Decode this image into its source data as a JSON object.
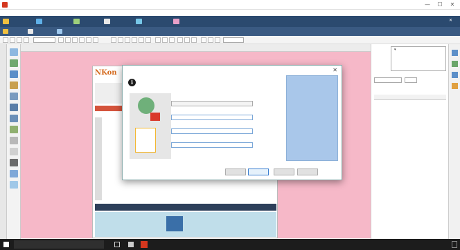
{
  "app": {
    "title": "",
    "window_controls": {
      "minimize": "—",
      "maximize": "☐",
      "close": "✕"
    }
  },
  "menubar": {
    "items": [
      "",
      "",
      "",
      "",
      "",
      "",
      "",
      "",
      "",
      "",
      "",
      "",
      "",
      ""
    ]
  },
  "ribbon": {
    "tabs": [
      {
        "label": ""
      },
      {
        "label": ""
      },
      {
        "label": ""
      },
      {
        "label": ""
      },
      {
        "label": ""
      },
      {
        "label": ""
      },
      {
        "label": ""
      }
    ],
    "right_icons": [
      "",
      "",
      "✕"
    ]
  },
  "ribbon2": {
    "tabs": [
      {
        "label": ""
      },
      {
        "label": ""
      },
      {
        "label": ""
      },
      {
        "label": ""
      }
    ]
  },
  "toolbar": {
    "font_size_value": "",
    "style_dropdown": "",
    "right_dropdowns": [
      "",
      "",
      ""
    ]
  },
  "editor": {
    "tabs": [
      "",
      "",
      "",
      ""
    ],
    "logo_text": "NKon",
    "bottom_banner_left": "",
    "bottom_banner_right": ""
  },
  "dialog": {
    "title": "",
    "close": "✕",
    "instruction": "",
    "provider_label": "",
    "provider_value": "",
    "ftp_server_label": "",
    "ftp_server_value": "",
    "ftp_account_label": "",
    "ftp_account_value": "",
    "ftp_password_label": "",
    "ftp_password_value": "",
    "help_title": "",
    "help_paragraphs": [
      "",
      "",
      "",
      ""
    ],
    "buttons": {
      "back": "",
      "next": "",
      "cancel": "",
      "help": ""
    }
  },
  "right_panel": {
    "tree": [
      {
        "label": ""
      },
      {
        "label": ""
      },
      {
        "label": ""
      },
      {
        "label": ""
      },
      {
        "label": ""
      }
    ],
    "filter_value": "",
    "filter_button": "",
    "file_type": "",
    "column_name": "",
    "column_size": "",
    "bottom_buttons": [
      "",
      "",
      ""
    ]
  },
  "taskbar": {
    "search_placeholder": "",
    "time": "",
    "date": ""
  },
  "colors": {
    "ribbon": "#2b4a6f",
    "edit_bg": "#f6b8c8",
    "help_bg": "#a9c7ea",
    "taskbar": "#1c1c1c"
  }
}
